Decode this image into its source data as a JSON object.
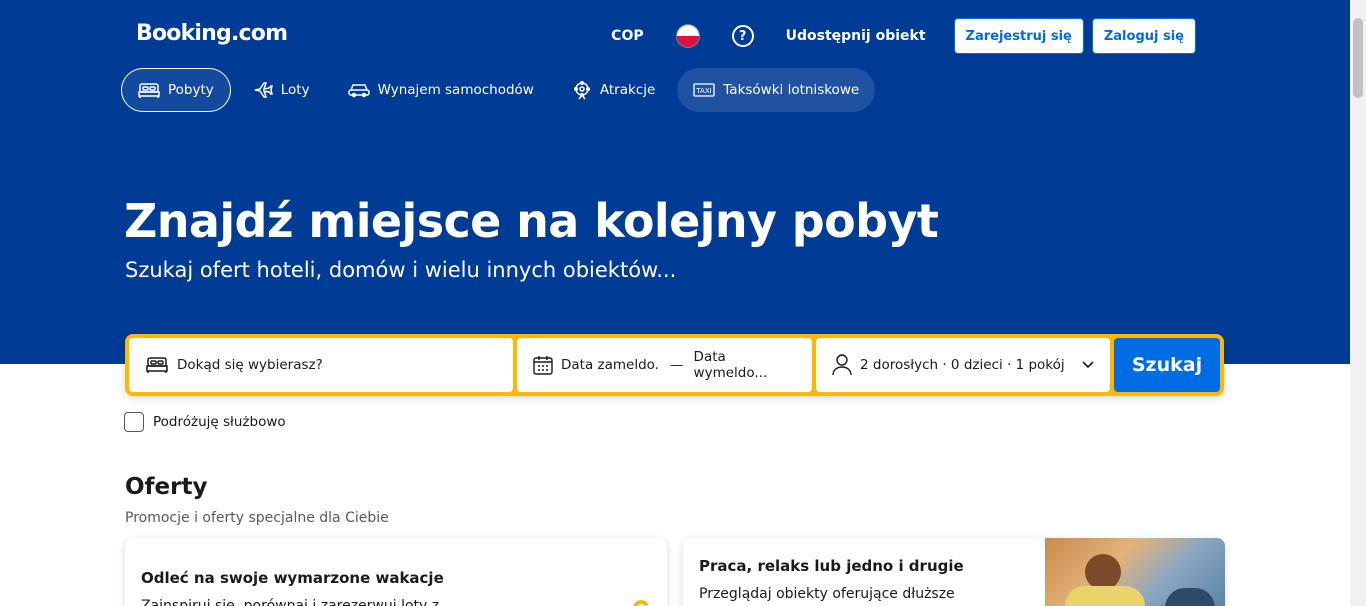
{
  "header": {
    "logo": "Booking.com",
    "currency": "COP",
    "help_symbol": "?",
    "list_property": "Udostępnij obiekt",
    "register": "Zarejestruj się",
    "login": "Zaloguj się"
  },
  "tabs": [
    {
      "label": "Pobyty",
      "icon": "bed-icon"
    },
    {
      "label": "Loty",
      "icon": "plane-icon"
    },
    {
      "label": "Wynajem samochodów",
      "icon": "car-icon"
    },
    {
      "label": "Atrakcje",
      "icon": "attractions-icon"
    },
    {
      "label": "Taksówki lotniskowe",
      "icon": "taxi-icon"
    }
  ],
  "hero": {
    "title": "Znajdź miejsce na kolejny pobyt",
    "subtitle": "Szukaj ofert hoteli, domów i wielu innych obiektów..."
  },
  "search": {
    "destination_placeholder": "Dokąd się wybierasz?",
    "checkin": "Data zameldo...",
    "date_separator": "—",
    "checkout": "Data wymeldo...",
    "guests": "2 dorosłych · 0 dzieci · 1 pokój",
    "submit": "Szukaj",
    "business_travel": "Podróżuję służbowo"
  },
  "offers": {
    "title": "Oferty",
    "subtitle": "Promocje i oferty specjalne dla Ciebie",
    "cards": [
      {
        "title": "Odleć na swoje wymarzone wakacje",
        "text": "Zainspiruj się, porównaj i zarezerwuj loty z"
      },
      {
        "title": "Praca, relaks lub jedno i drugie",
        "text": "Przeglądaj obiekty oferujące dłuższe"
      }
    ]
  },
  "colors": {
    "brand_blue": "#003b95",
    "accent_yellow": "#ffb700",
    "button_blue": "#006ce4"
  }
}
